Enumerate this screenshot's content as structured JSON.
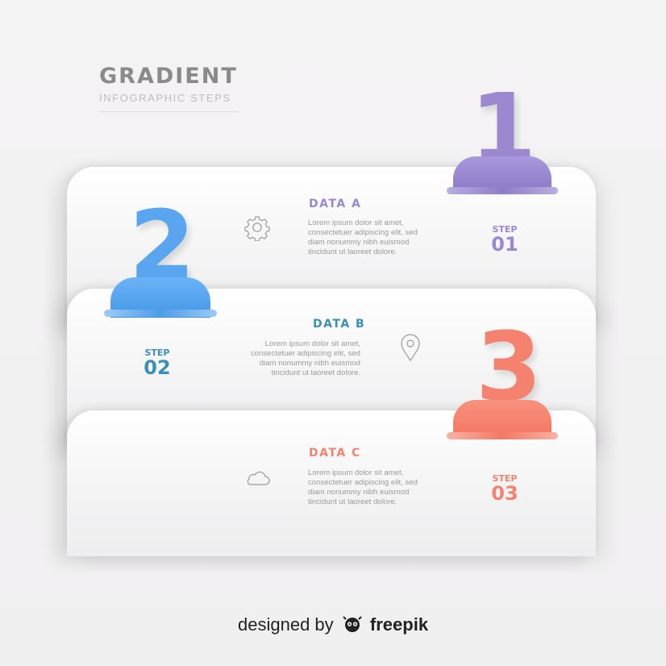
{
  "header": {
    "title": "GRADIENT",
    "subtitle": "INFOGRAPHIC STEPS"
  },
  "colors": {
    "purple": "#9b88cf",
    "blue": "#5aa5f0",
    "salmon": "#f4826f",
    "teal": "#3a8fb8",
    "text_gray": "#9a9a9a"
  },
  "steps": [
    {
      "digit": "1",
      "data_title": "DATA  A",
      "step_label": "STEP",
      "step_number": "01",
      "icon": "gear-icon",
      "lorem": [
        "Lorem ipsum dolor sit amet,",
        "consectetuer adipiscing elit, sed",
        "diam nonummy nibh euismod",
        "tincidunt ut laoreet dolore."
      ]
    },
    {
      "digit": "2",
      "data_title": "DATA  B",
      "step_label": "STEP",
      "step_number": "02",
      "icon": "location-pin-icon",
      "lorem": [
        "Lorem ipsum dolor sit amet,",
        "consectetuer adipiscing elit, sed",
        "diam nonummy nibh euismod",
        "tincidunt ut laoreet dolore."
      ]
    },
    {
      "digit": "3",
      "data_title": "DATA  C",
      "step_label": "STEP",
      "step_number": "03",
      "icon": "cloud-icon",
      "lorem": [
        "Lorem ipsum dolor sit amet,",
        "consectetuer adipiscing elit, sed",
        "diam nonummy nibh euismod",
        "tincidunt ut laoreet dolore."
      ]
    }
  ],
  "credit": {
    "prefix": "designed by",
    "brand": "freepik"
  }
}
